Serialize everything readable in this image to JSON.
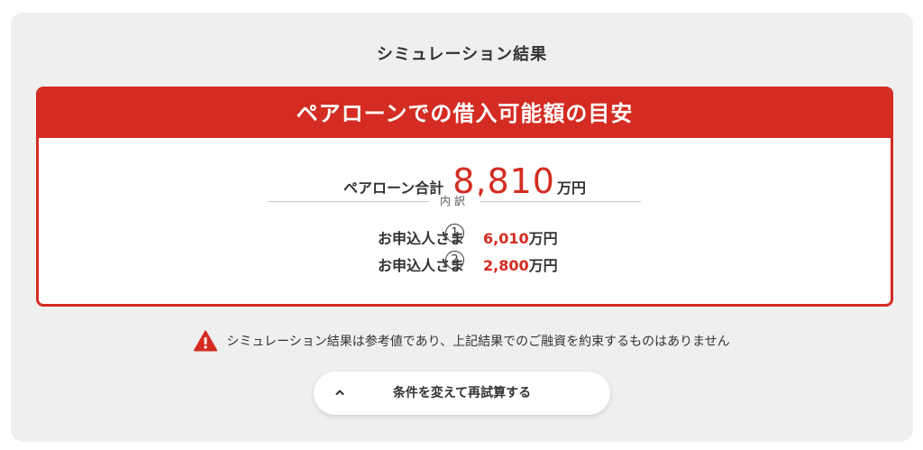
{
  "panel": {
    "title": "シミュレーション結果"
  },
  "card": {
    "header": "ペアローンでの借入可能額の目安",
    "total_label": "ペアローン合計",
    "total_value": "8,810",
    "total_unit": "万円",
    "breakdown_label": "内訳",
    "applicants": [
      {
        "label": "お申込人さま",
        "number": "1",
        "amount": "6,010",
        "unit": "万円"
      },
      {
        "label": "お申込人さま",
        "number": "2",
        "amount": "2,800",
        "unit": "万円"
      }
    ]
  },
  "notice": {
    "icon": "warning-icon",
    "text": "シミュレーション結果は参考値であり、上記結果でのご融資を約束するものはありません"
  },
  "recalc_button": {
    "icon": "chevron-up-icon",
    "label": "条件を変えて再試算する"
  },
  "colors": {
    "accent": "#d42c22",
    "panel_bg": "#efefef",
    "text": "#333333"
  }
}
